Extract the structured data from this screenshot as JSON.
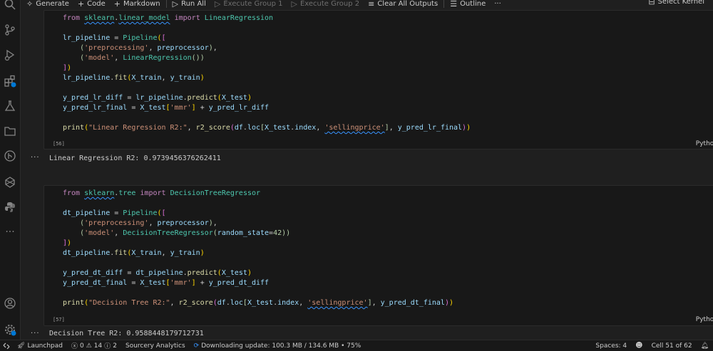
{
  "toolbar": {
    "generate": "Generate",
    "code": "Code",
    "markdown": "Markdown",
    "run_all": "Run All",
    "execute_group_1": "Execute Group 1",
    "execute_group_2": "Execute Group 2",
    "clear_all_outputs": "Clear All Outputs",
    "outline": "Outline",
    "more": "···",
    "select_kernel": "Select Kernel"
  },
  "cells": [
    {
      "execution_count": "[56]",
      "language": "Python",
      "output": "Linear Regression R2: 0.9739456376262411"
    },
    {
      "execution_count": "[57]",
      "language": "Python",
      "output": "Decision Tree R2: 0.9588448179712731"
    }
  ],
  "output_dots": "···",
  "statusbar": {
    "launchpad": "Launchpad",
    "errors": "0",
    "warnings": "14",
    "info": "2",
    "sourcery": "Sourcery Analytics",
    "download": "Downloading update: 100.3 MB / 134.6 MB • 75%",
    "spaces": "Spaces: 4",
    "cell_position": "Cell 51 of 62"
  },
  "colors": {
    "background": "#1f1f1f",
    "cell_background": "#181818",
    "keyword": "#c586c0",
    "string": "#ce9178",
    "function": "#dcdcaa"
  }
}
